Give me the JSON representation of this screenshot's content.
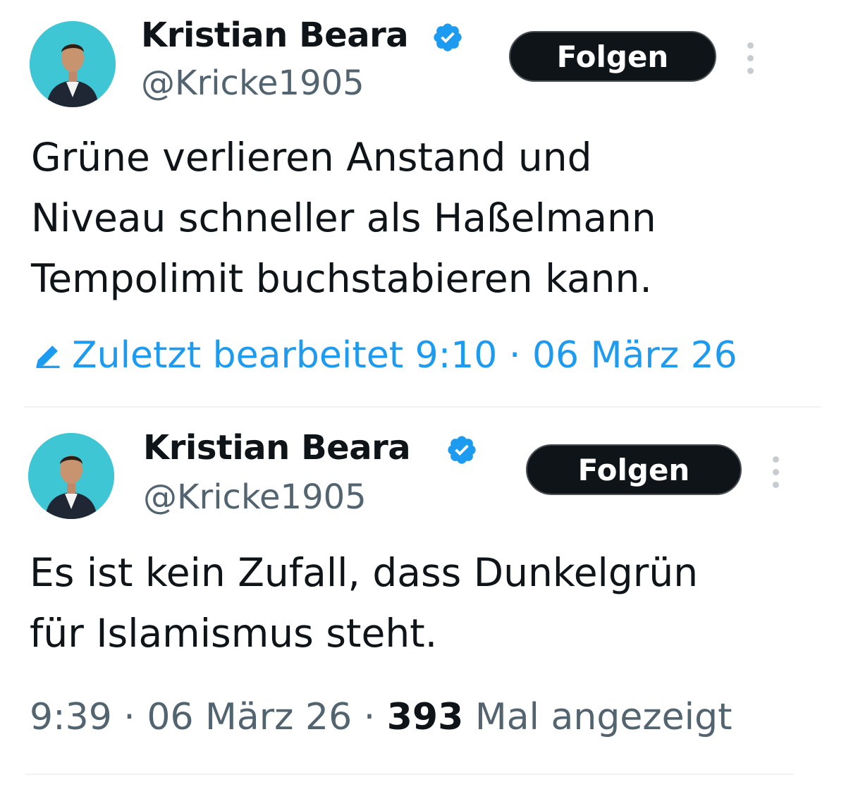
{
  "tweets": [
    {
      "author": {
        "name": "Kristian Beara",
        "handle": "@Kricke1905"
      },
      "follow_label": "Folgen",
      "text": "Grüne verlieren Anstand und\nNiveau schneller als Haßelmann\nTempolimit buchstabieren kann.",
      "edited_label": "Zuletzt bearbeitet 9:10 · 06 März 26"
    },
    {
      "author": {
        "name": "Kristian Beara",
        "handle": "@Kricke1905"
      },
      "follow_label": "Folgen",
      "text": "Es ist kein Zufall, dass Dunkelgrün\nfür Islamismus steht.",
      "time": "9:39 · 06 März 26 · ",
      "views_count": "393",
      "views_label": " Mal angezeigt"
    }
  ],
  "colors": {
    "verified": "#1d9bf0",
    "follow_bg": "#0f1419",
    "secondary_text": "#536471",
    "avatar_bg": "#3ec6d4"
  }
}
